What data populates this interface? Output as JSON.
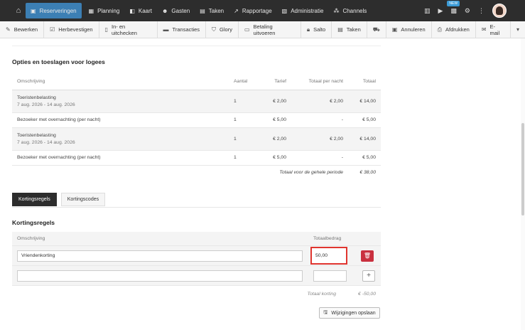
{
  "topnav": {
    "items": [
      {
        "label": "Reserveringen",
        "icon": "calendar-icon",
        "active": true
      },
      {
        "label": "Planning",
        "icon": "grid-icon"
      },
      {
        "label": "Kaart",
        "icon": "map-icon"
      },
      {
        "label": "Gasten",
        "icon": "users-icon"
      },
      {
        "label": "Taken",
        "icon": "clipboard-icon"
      },
      {
        "label": "Rapportage",
        "icon": "chart-icon"
      },
      {
        "label": "Administratie",
        "icon": "folder-icon"
      },
      {
        "label": "Channels",
        "icon": "channels-icon"
      }
    ],
    "badge": "NEW"
  },
  "toolbar": {
    "items": [
      {
        "label": "Bewerken",
        "icon": "edit-icon"
      },
      {
        "label": "Herbevestigen",
        "icon": "check-icon"
      },
      {
        "label": "In- en uitchecken",
        "icon": "door-icon"
      },
      {
        "label": "Transacties",
        "icon": "card-icon"
      },
      {
        "label": "Glory",
        "icon": "cash-icon"
      },
      {
        "label": "Betaling uitvoeren",
        "icon": "payment-icon"
      },
      {
        "label": "Salto",
        "icon": "lock-icon"
      },
      {
        "label": "Taken",
        "icon": "tasks-icon"
      },
      {
        "label": "",
        "icon": "car-icon"
      },
      {
        "label": "Annuleren",
        "icon": "cancel-icon"
      },
      {
        "label": "Afdrukken",
        "icon": "print-icon"
      },
      {
        "label": "E-mail",
        "icon": "mail-icon"
      }
    ]
  },
  "options": {
    "title": "Opties en toeslagen voor logees",
    "columns": [
      "Omschrijving",
      "Aantal",
      "Tarief",
      "Totaal per nacht",
      "Totaal"
    ],
    "rows": [
      {
        "desc": "Toeristenbelasting",
        "sub": "7 aug. 2026 - 14 aug. 2026",
        "qty": "1",
        "rate": "€ 2,00",
        "per_night": "€ 2,00",
        "total": "€ 14,00"
      },
      {
        "desc": "Bezoeker met overnachting (per nacht)",
        "sub": "",
        "qty": "1",
        "rate": "€ 5,00",
        "per_night": "-",
        "total": "€ 5,00"
      },
      {
        "desc": "Toeristenbelasting",
        "sub": "7 aug. 2026 - 14 aug. 2026",
        "qty": "1",
        "rate": "€ 2,00",
        "per_night": "€ 2,00",
        "total": "€ 14,00"
      },
      {
        "desc": "Bezoeker met overnachting (per nacht)",
        "sub": "",
        "qty": "1",
        "rate": "€ 5,00",
        "per_night": "-",
        "total": "€ 5,00"
      }
    ],
    "total_label": "Totaal voor de gehele periode",
    "total_value": "€ 38,00"
  },
  "tabs": [
    "Kortingsregels",
    "Kortingscodes"
  ],
  "discounts": {
    "title": "Kortingsregels",
    "col_desc": "Omschrijving",
    "col_amount": "Totaalbedrag",
    "row": {
      "desc": "Vriendenkorting",
      "amount": "50,00"
    },
    "new_desc": "",
    "new_amount": "",
    "total_label": "Totaal korting",
    "total_value": "€ -50,00"
  },
  "save_label": "Wijzigingen opslaan",
  "colors": {
    "accent": "#3c7fb4",
    "danger": "#c9303f",
    "highlight": "#e0352f"
  }
}
